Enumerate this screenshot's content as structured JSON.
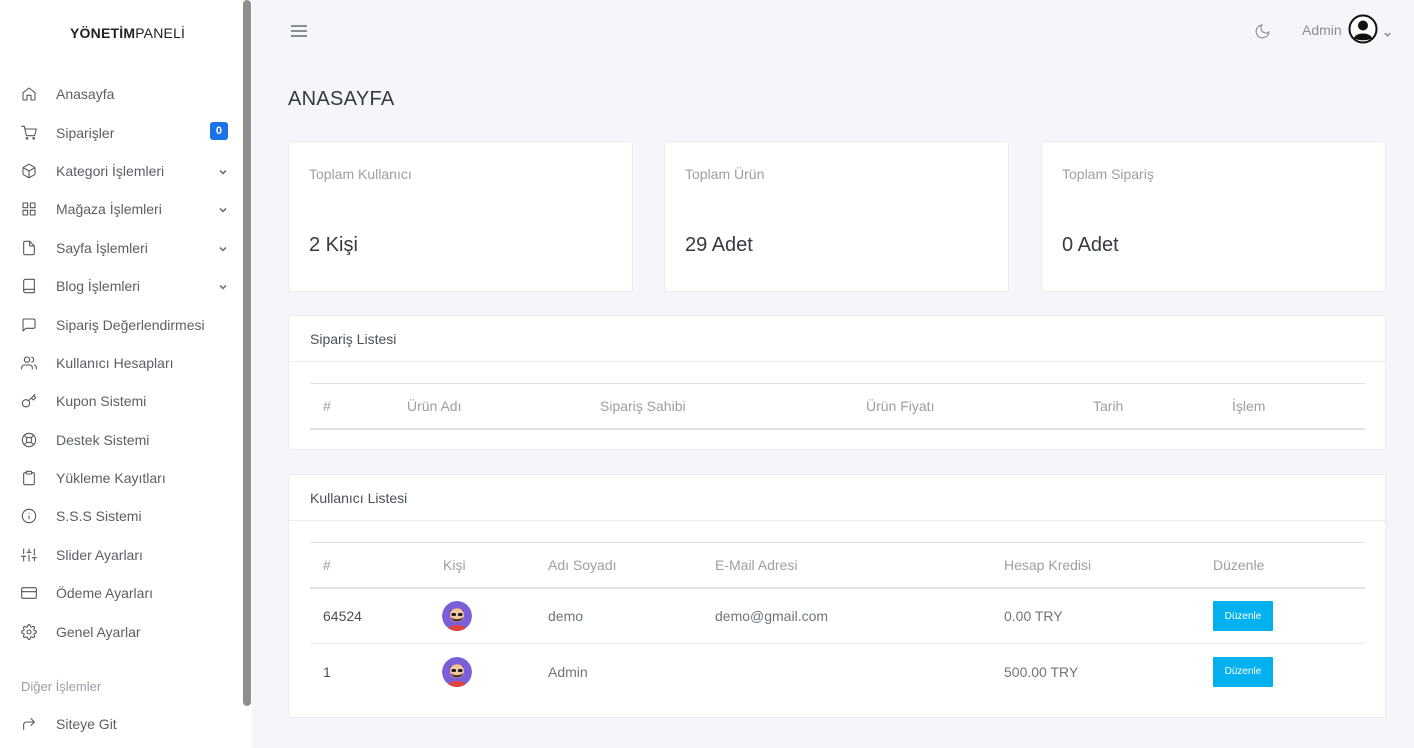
{
  "brand": {
    "bold": "YÖNETİM",
    "light": "PANELİ"
  },
  "sidebar": {
    "items": [
      {
        "label": "Anasayfa",
        "icon": "home-icon"
      },
      {
        "label": "Siparişler",
        "icon": "cart-icon",
        "badge": "0"
      },
      {
        "label": "Kategori İşlemleri",
        "icon": "box-icon",
        "expandable": true
      },
      {
        "label": "Mağaza İşlemleri",
        "icon": "grid-icon",
        "expandable": true
      },
      {
        "label": "Sayfa İşlemleri",
        "icon": "file-icon",
        "expandable": true
      },
      {
        "label": "Blog İşlemleri",
        "icon": "book-icon",
        "expandable": true
      },
      {
        "label": "Sipariş Değerlendirmesi",
        "icon": "message-square-icon"
      },
      {
        "label": "Kullanıcı Hesapları",
        "icon": "users-icon"
      },
      {
        "label": "Kupon Sistemi",
        "icon": "key-icon"
      },
      {
        "label": "Destek Sistemi",
        "icon": "life-buoy-icon"
      },
      {
        "label": "Yükleme Kayıtları",
        "icon": "clipboard-icon"
      },
      {
        "label": "S.S.S Sistemi",
        "icon": "info-icon"
      },
      {
        "label": "Slider Ayarları",
        "icon": "sliders-icon"
      },
      {
        "label": "Ödeme Ayarları",
        "icon": "credit-card-icon"
      },
      {
        "label": "Genel Ayarlar",
        "icon": "settings-icon"
      }
    ],
    "section_title": "Diğer İşlemler",
    "bottom_items": [
      {
        "label": "Siteye Git",
        "icon": "share-arrow-icon"
      }
    ]
  },
  "topbar": {
    "user_name": "Admin"
  },
  "page": {
    "title": "ANASAYFA"
  },
  "stats": [
    {
      "title": "Toplam Kullanıcı",
      "value": "2 Kişi"
    },
    {
      "title": "Toplam Ürün",
      "value": "29 Adet"
    },
    {
      "title": "Toplam Sipariş",
      "value": "0 Adet"
    }
  ],
  "orders": {
    "title": "Sipariş Listesi",
    "columns": [
      "#",
      "Ürün Adı",
      "Sipariş Sahibi",
      "Ürün Fiyatı",
      "Tarih",
      "İşlem"
    ]
  },
  "users": {
    "title": "Kullanıcı Listesi",
    "columns": [
      "#",
      "Kişi",
      "Adı Soyadı",
      "E-Mail Adresi",
      "Hesap Kredisi",
      "Düzenle"
    ],
    "rows": [
      {
        "id": "64524",
        "name": "demo",
        "email": "demo@gmail.com",
        "credit": "0.00 TRY",
        "action": "Düzenle"
      },
      {
        "id": "1",
        "name": "Admin",
        "email": "",
        "credit": "500.00 TRY",
        "action": "Düzenle"
      }
    ]
  },
  "colors": {
    "accent": "#1a73e8",
    "edit_button": "#03b0f0",
    "background": "#f5f6f9"
  }
}
